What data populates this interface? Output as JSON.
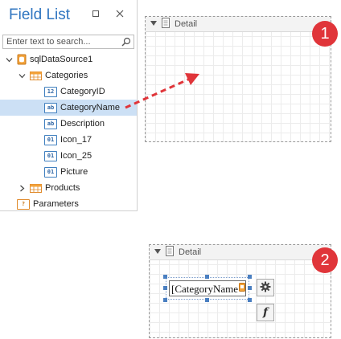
{
  "field_list": {
    "title": "Field List",
    "search_placeholder": "Enter text to search...",
    "tree": {
      "datasource": "sqlDataSource1",
      "categories": "Categories",
      "fields": [
        {
          "label": "CategoryID",
          "type_badge": "12"
        },
        {
          "label": "CategoryName",
          "type_badge": "ab"
        },
        {
          "label": "Description",
          "type_badge": "ab"
        },
        {
          "label": "Icon_17",
          "type_badge": "01"
        },
        {
          "label": "Icon_25",
          "type_badge": "01"
        },
        {
          "label": "Picture",
          "type_badge": "01"
        }
      ],
      "products": "Products",
      "parameters": "Parameters",
      "parameters_badge": "?"
    }
  },
  "step1": {
    "badge": "1",
    "band_label": "Detail"
  },
  "step2": {
    "badge": "2",
    "band_label": "Detail",
    "label_text": "[CategoryName",
    "function_glyph": "f"
  },
  "colors": {
    "accent": "#2f75c0",
    "badge": "#e0353a",
    "drag_arrow": "#e0353a",
    "selection": "#cce0f5"
  },
  "icons": [
    "restore-icon",
    "close-icon",
    "search-icon",
    "database-icon",
    "table-icon",
    "gear-icon",
    "function-icon"
  ]
}
